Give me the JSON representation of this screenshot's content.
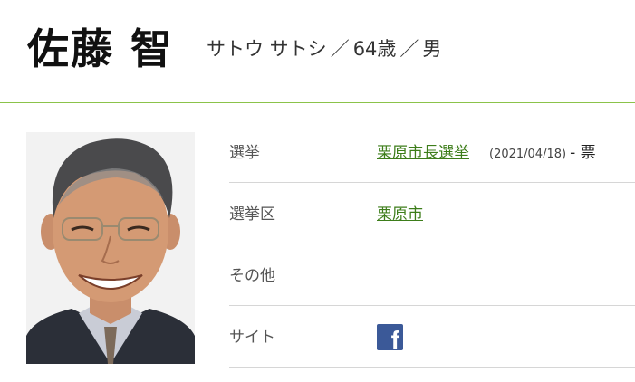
{
  "profile": {
    "name": "佐藤 智",
    "kana": "サトウ サトシ",
    "age": "64歳",
    "gender": "男",
    "separator": "／"
  },
  "rows": {
    "election": {
      "label": "選挙",
      "link": "栗原市長選挙",
      "date": "(2021/04/18)",
      "result": "- 票"
    },
    "district": {
      "label": "選挙区",
      "link": "栗原市"
    },
    "other": {
      "label": "その他"
    },
    "site": {
      "label": "サイト",
      "icon": "facebook-icon",
      "icon_glyph": "f"
    }
  },
  "colors": {
    "link": "#3d7d1a",
    "divider": "#8bc34a",
    "facebook": "#3b5998"
  }
}
